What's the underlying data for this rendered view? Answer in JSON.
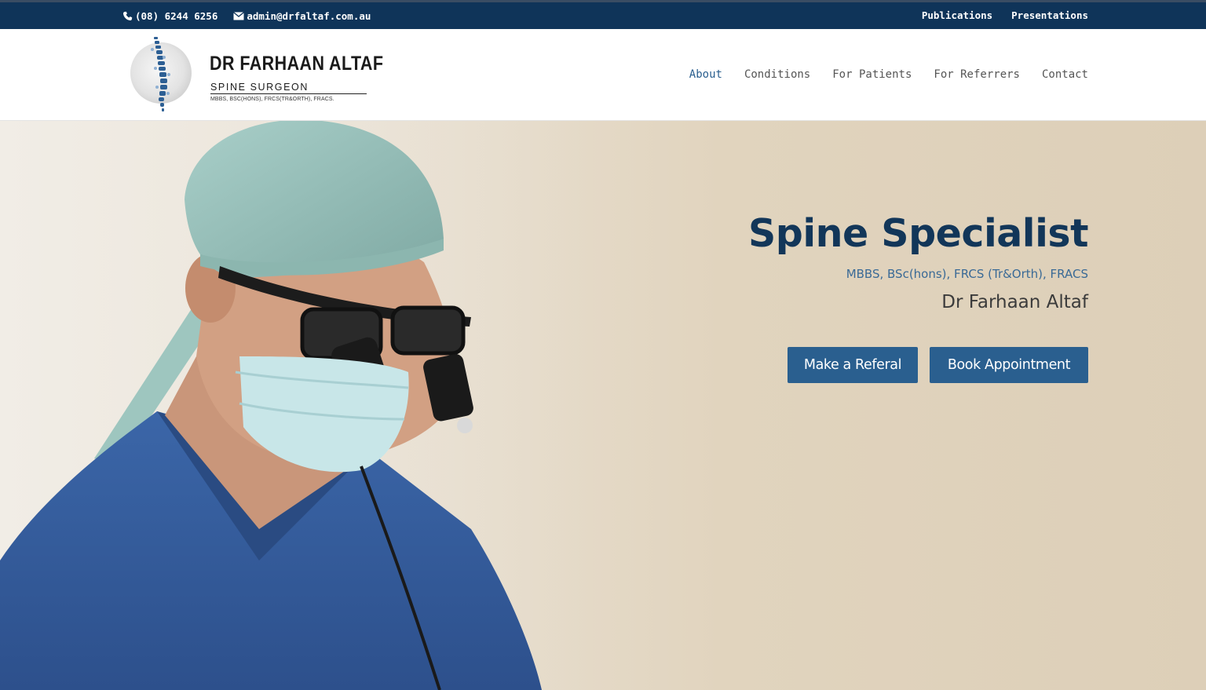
{
  "topbar": {
    "phone": "(08) 6244 6256",
    "email": "admin@drfaltaf.com.au",
    "phone_icon": "phone-icon",
    "email_icon": "envelope-icon",
    "links": [
      "Publications",
      "Presentations"
    ]
  },
  "logo": {
    "name": "DR FARHAAN ALTAF",
    "subtitle": "SPINE SURGEON",
    "qualifications": "MBBS, BSC(HONS), FRCS(TR&ORTH), FRACS.",
    "icon": "spine-icon"
  },
  "nav": {
    "items": [
      "About",
      "Conditions",
      "For Patients",
      "For Referrers",
      "Contact"
    ],
    "active": "About"
  },
  "hero": {
    "title": "Spine Specialist",
    "qualifications": "MBBS, BSc(hons), FRCS (Tr&Orth), FRACS",
    "name": "Dr Farhaan Altaf",
    "buttons": {
      "referral": "Make a Referal",
      "book": "Book Appointment"
    }
  },
  "colors": {
    "topbar_bg": "#0f3459",
    "accent": "#2a5f8f",
    "title": "#123659",
    "hero_bg": "#e1d4bf"
  }
}
